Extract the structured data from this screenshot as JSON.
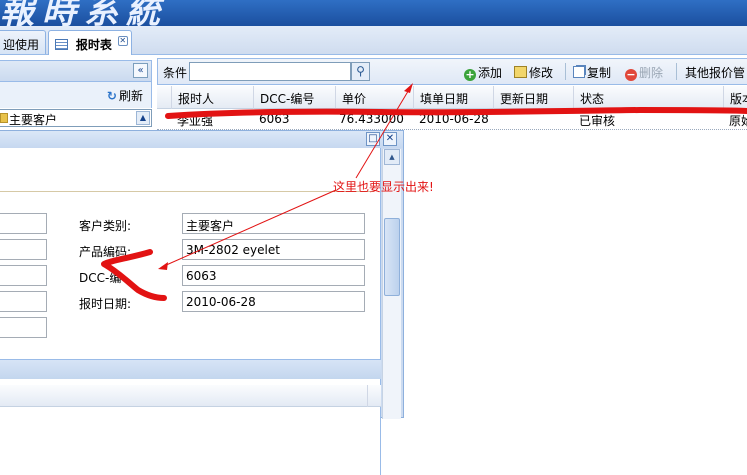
{
  "banner": {
    "title": "報時系統"
  },
  "tabs": [
    {
      "label": "迎使用"
    },
    {
      "label": "报时表"
    }
  ],
  "left_panel": {
    "refresh_label": "刷新",
    "combo_value": "主要客户"
  },
  "toolbar": {
    "condition_label": "条件",
    "search_value": "",
    "add_label": "添加",
    "edit_label": "修改",
    "copy_label": "复制",
    "delete_label": "删除",
    "other_label": "其他报价管"
  },
  "grid": {
    "columns": [
      "报时人",
      "DCC-编号",
      "单价",
      "填单日期",
      "更新日期",
      "状态",
      "版本"
    ],
    "rows": [
      [
        "李亚强",
        "6063",
        "76.433000",
        "2010-06-28",
        "",
        "已审核",
        "原始"
      ]
    ]
  },
  "dialog": {
    "fields": [
      {
        "label": "客户类别:",
        "value": "主要客户"
      },
      {
        "label": "产品编码:",
        "value": "3M-2802 eyelet"
      },
      {
        "label": "DCC-编",
        "value": "6063"
      },
      {
        "label": "报时日期:",
        "value": "2010-06-28"
      }
    ]
  },
  "annotation": {
    "note": "这里也要显示出来!",
    "color": "#e21313"
  }
}
